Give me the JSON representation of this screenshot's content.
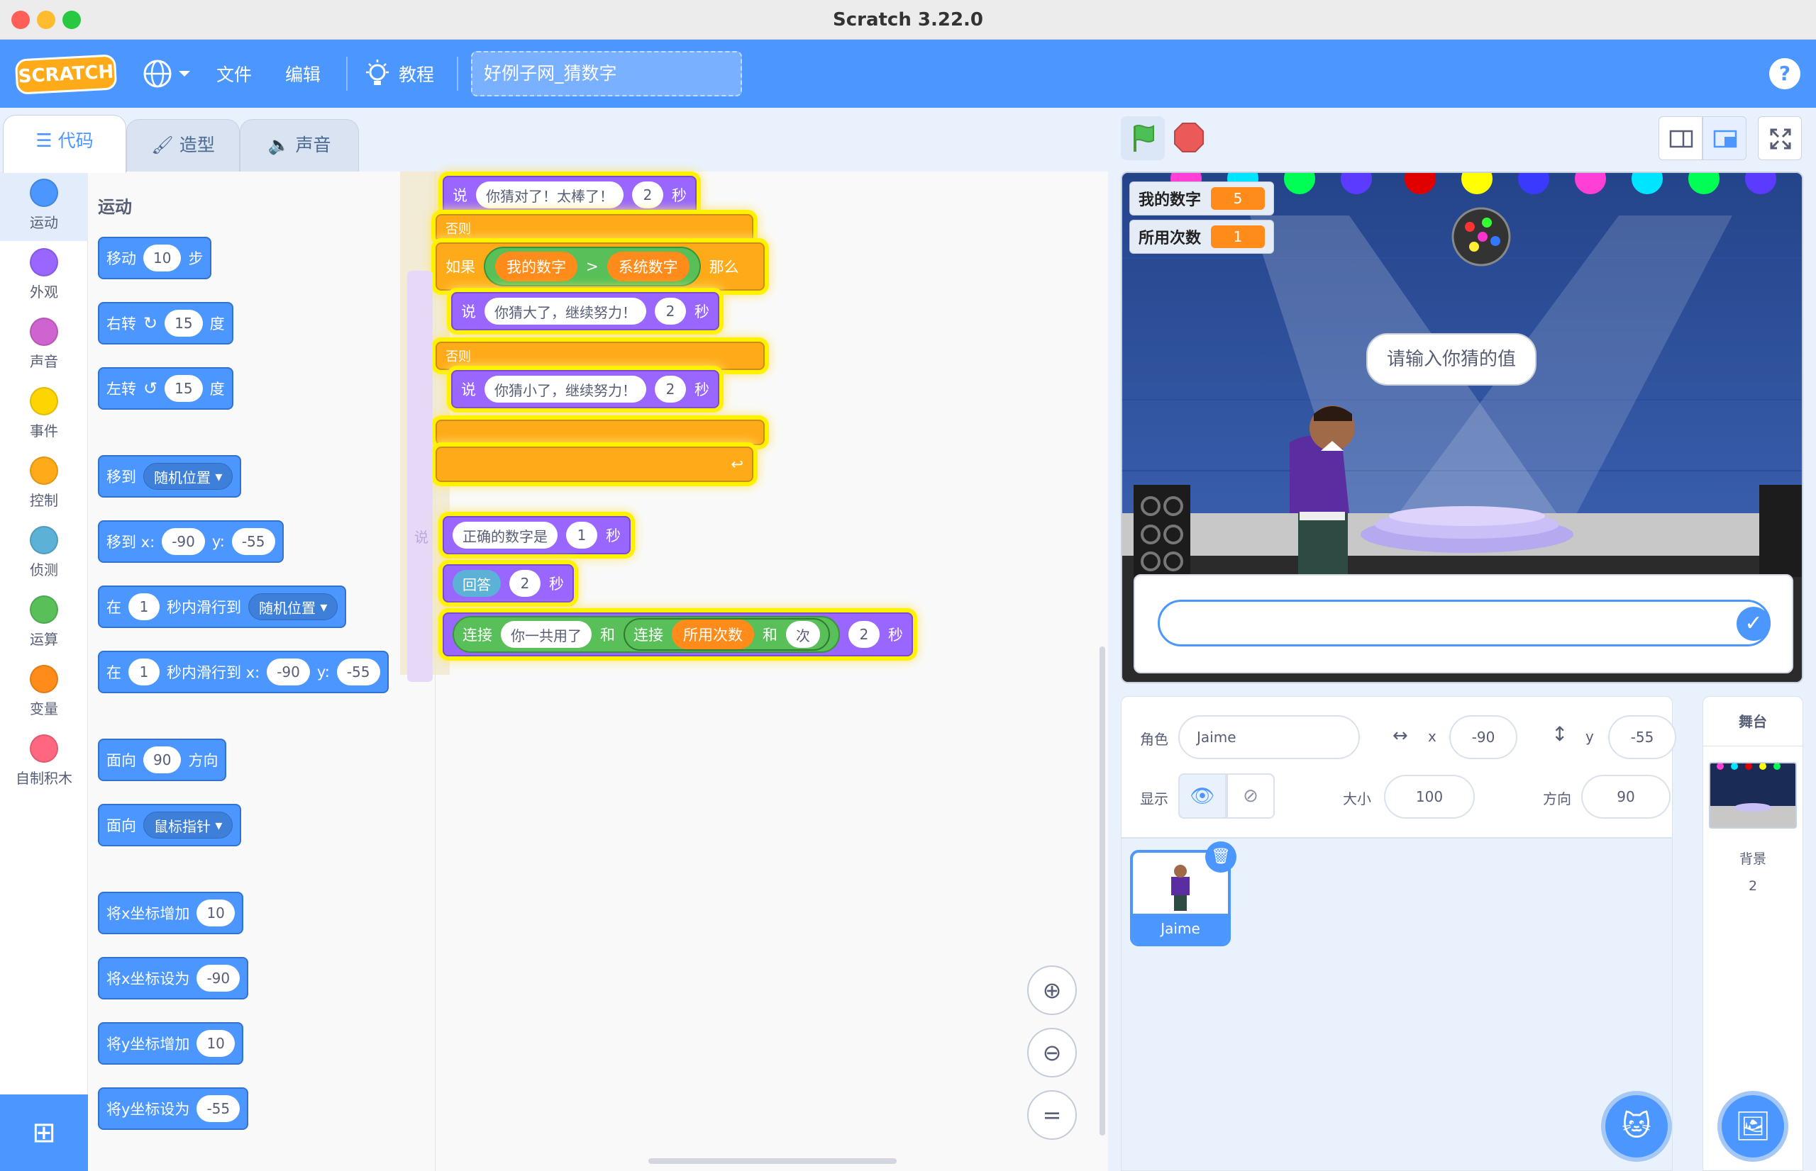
{
  "app": {
    "title": "Scratch 3.22.0"
  },
  "menubar": {
    "logo": "SCRATCH",
    "file": "文件",
    "edit": "编辑",
    "tutorials": "教程",
    "project_title": "好例子网_猜数字"
  },
  "tabs": {
    "code": "代码",
    "costumes": "造型",
    "sounds": "声音"
  },
  "categories": [
    {
      "label": "运动",
      "color": "#4c97ff"
    },
    {
      "label": "外观",
      "color": "#9966ff"
    },
    {
      "label": "声音",
      "color": "#cf63cf"
    },
    {
      "label": "事件",
      "color": "#ffd500"
    },
    {
      "label": "控制",
      "color": "#ffab19"
    },
    {
      "label": "侦测",
      "color": "#5cb1d6"
    },
    {
      "label": "运算",
      "color": "#59c059"
    },
    {
      "label": "变量",
      "color": "#ff8c1a"
    },
    {
      "label": "自制积木",
      "color": "#ff6680"
    }
  ],
  "palette": {
    "heading": "运动",
    "move": {
      "a": "移动",
      "v": "10",
      "b": "步"
    },
    "turn_right": {
      "a": "右转",
      "v": "15",
      "b": "度"
    },
    "turn_left": {
      "a": "左转",
      "v": "15",
      "b": "度"
    },
    "goto": {
      "a": "移到",
      "dd": "随机位置"
    },
    "goto_xy": {
      "a": "移到 x:",
      "x": "-90",
      "b": "y:",
      "y": "-55"
    },
    "glide_random": {
      "a": "在",
      "v": "1",
      "b": "秒内滑行到",
      "dd": "随机位置"
    },
    "glide_xy": {
      "a": "在",
      "v": "1",
      "b": "秒内滑行到 x:",
      "x": "-90",
      "c": "y:",
      "y": "-55"
    },
    "point_dir": {
      "a": "面向",
      "v": "90",
      "b": "方向"
    },
    "point_towards": {
      "a": "面向",
      "dd": "鼠标指针"
    },
    "change_x": {
      "a": "将x坐标增加",
      "v": "10"
    },
    "set_x": {
      "a": "将x坐标设为",
      "v": "-90"
    },
    "change_y": {
      "a": "将y坐标增加",
      "v": "10"
    },
    "set_y": {
      "a": "将y坐标设为",
      "v": "-55"
    }
  },
  "script": {
    "say_correct": {
      "a": "说",
      "text": "你猜对了！太棒了！",
      "secs": "2",
      "b": "秒"
    },
    "else1": "否则",
    "if_label": "如果",
    "cond_left": "我的数字",
    "cond_op": ">",
    "cond_right": "系统数字",
    "then": "那么",
    "say_big": {
      "a": "说",
      "text": "你猜大了，继续努力！",
      "secs": "2",
      "b": "秒"
    },
    "else2": "否则",
    "say_small": {
      "a": "说",
      "text": "你猜小了，继续努力！",
      "secs": "2",
      "b": "秒"
    },
    "say_answer": {
      "a": "正确的数字是",
      "v": "1",
      "b": "秒"
    },
    "ghost_label": "说",
    "say_reply": {
      "a": "回答",
      "v": "2",
      "b": "秒"
    },
    "say_join": {
      "join1": "连接",
      "text1": "你一共用了",
      "and1": "和",
      "join2": "连接",
      "var": "所用次数",
      "and2": "和",
      "text2": "次",
      "secs": "2",
      "b": "秒"
    }
  },
  "stage": {
    "monitors": [
      {
        "label": "我的数字",
        "value": "5"
      },
      {
        "label": "所用次数",
        "value": "1"
      }
    ],
    "speech": "请输入你猜的值",
    "ask_input": ""
  },
  "sprite": {
    "label_sprite": "角色",
    "name": "Jaime",
    "label_x": "x",
    "x": "-90",
    "label_y": "y",
    "y": "-55",
    "label_show": "显示",
    "label_size": "大小",
    "size": "100",
    "label_dir": "方向",
    "direction": "90",
    "thumb_name": "Jaime"
  },
  "stagepanel": {
    "heading": "舞台",
    "backdrop_label": "背景",
    "backdrop_count": "2"
  }
}
